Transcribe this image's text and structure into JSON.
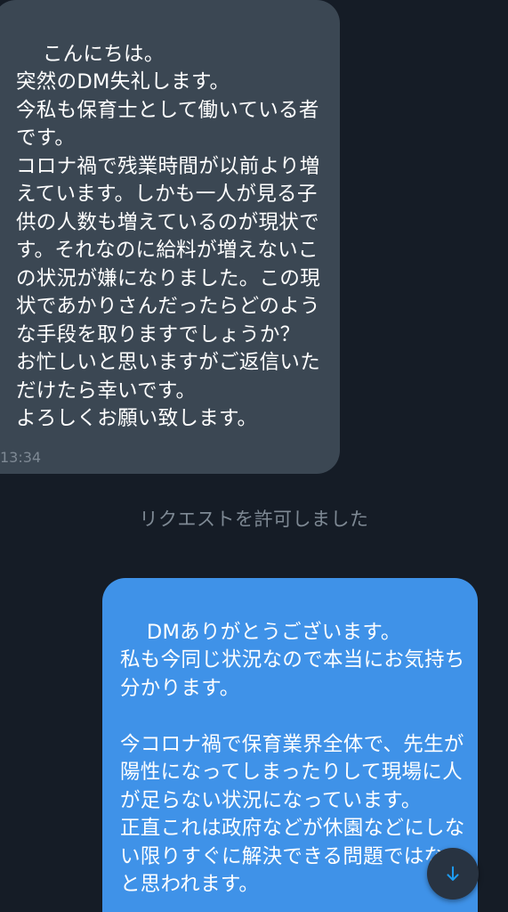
{
  "conversation": {
    "incoming": {
      "text": "こんにちは。\n突然のDM失礼します。\n今私も保育士として働いている者です。\nコロナ禍で残業時間が以前より増えています。しかも一人が見る子供の人数も増えているのが現状です。それなのに給料が増えないこの状況が嫌になりました。この現状であかりさんだったらどのような手段を取りますでしょうか？\nお忙しいと思いますがご返信いただけたら幸いです。\nよろしくお願い致します。",
      "time": "13:34"
    },
    "system_message": "リクエストを許可しました",
    "outgoing": {
      "text": "DMありがとうございます。\n私も今同じ状況なので本当にお気持ち分かります。\n\n今コロナ禍で保育業界全体で、先生が陽性になってしまったりして現場に人が足らない状況になっています。\n正直これは政府などが休園などにしない限りすぐに解決できる問題ではないと思われます。"
    }
  },
  "colors": {
    "background": "#151c26",
    "incoming_bubble": "#3b4753",
    "outgoing_bubble": "#3f92e8",
    "muted_text": "#7e8994",
    "accent": "#1d9bf0"
  },
  "icons": {
    "scroll_down": "arrow-down-icon"
  }
}
